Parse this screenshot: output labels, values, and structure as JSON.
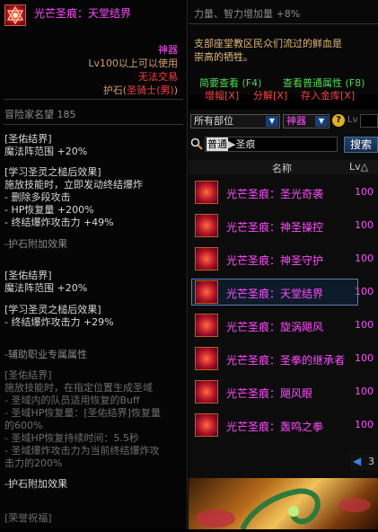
{
  "tooltip": {
    "item_name": "光芒圣痕：天堂结界",
    "type": "神器",
    "level_req": "Lv100以上可以使用",
    "trade": "无法交易",
    "slot": "护石(",
    "slot_class": "圣骑士(男)",
    "slot_end": ")",
    "adventurer_fame_label": "冒险家名望",
    "adventurer_fame_value": "185",
    "sections": [
      {
        "lines": [
          "[圣佑结界]",
          "魔法阵范围 +20%"
        ]
      },
      {
        "lines": [
          "[学习圣灵之槌后效果]",
          "施放技能时，立即发动终结爆炸",
          "- 删除多段攻击",
          "- HP恢复量 +200%",
          "- 终结爆炸攻击力 +49%"
        ]
      },
      {
        "lines": [
          "-护石附加效果"
        ]
      },
      {
        "lines": [
          "[圣佑结界]",
          "魔法阵范围 +20%"
        ]
      },
      {
        "lines": [
          "[学习圣灵之槌后效果]",
          "- 终结爆炸攻击力 +29%"
        ]
      },
      {
        "lines": [
          "-辅助职业专属属性"
        ]
      },
      {
        "lines": [
          "[圣佑结界]",
          "施放技能时，在指定位置生成圣域",
          "- 圣域内的队员适用恢复的Buff",
          "- 圣域HP恢复量：[圣佑结界]恢复量",
          "的600%",
          "- 圣域HP恢复持续时间：5.5秒",
          "- 圣域爆炸攻击力为当前终结爆炸攻",
          "击力的200%"
        ]
      },
      {
        "lines": [
          "-护石附加效果"
        ]
      },
      {
        "lines": [
          "[荣誉祝福]"
        ]
      }
    ]
  },
  "description": {
    "top_line": "力量、智力增加量 +8%",
    "flavor_1": "支部座堂教区民众们流过的鲜血是",
    "flavor_2": "崇高的牺牲。",
    "compare_simple": "简要查看 (F4)",
    "compare_normal": "查看普通属性 (F8)",
    "action_amplify": "增幅[X]",
    "action_disassemble": "分解[X]",
    "action_store": "存入金库[X]"
  },
  "filters": {
    "category": "所有部位",
    "rarity": "神器",
    "help_icon": "?",
    "lv_label": "Lv"
  },
  "search": {
    "mode": "普通",
    "mode_arrow": "▶",
    "query": "圣痕",
    "button": "搜索"
  },
  "list_header": {
    "name_col": "名称",
    "lv_col": "Lv△"
  },
  "items": [
    {
      "name": "光芒圣痕：圣光奇袭",
      "lv": "100"
    },
    {
      "name": "光芒圣痕：神圣操控",
      "lv": "100"
    },
    {
      "name": "光芒圣痕：神圣守护",
      "lv": "100"
    },
    {
      "name": "光芒圣痕：天堂结界",
      "lv": "100"
    },
    {
      "name": "光芒圣痕：旋涡飓风",
      "lv": "100"
    },
    {
      "name": "光芒圣痕：圣拳的继承者",
      "lv": "100"
    },
    {
      "name": "光芒圣痕：飓风眼",
      "lv": "100"
    },
    {
      "name": "光芒圣痕：轰鸣之拳",
      "lv": "100"
    }
  ],
  "pager": {
    "prev": "◀",
    "page": "3"
  },
  "colors": {
    "epic_name": "#ff4dff",
    "class_red": "#ff3b3b",
    "compare_green": "#4fd84f",
    "action_red": "#ff4040",
    "level_req_orange": "#d2a070"
  }
}
